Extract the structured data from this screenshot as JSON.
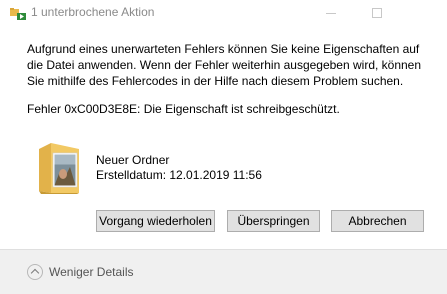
{
  "window": {
    "title": "1 unterbrochene Aktion",
    "title_icon": "folder-move-icon"
  },
  "dialog": {
    "message": "Aufgrund eines unerwarteten Fehlers können Sie keine Eigenschaften auf die Datei anwenden. Wenn der Fehler weiterhin ausgegeben wird, können Sie mithilfe des Fehlercodes in der Hilfe nach diesem Problem suchen.",
    "error": "Fehler 0xC00D3E8E: Die Eigenschaft ist schreibgeschützt.",
    "item": {
      "name": "Neuer Ordner",
      "created": "Erstelldatum: 12.01.2019 11:56",
      "icon": "folder-icon"
    },
    "buttons": {
      "retry": "Vorgang wiederholen",
      "skip": "Überspringen",
      "cancel": "Abbrechen"
    }
  },
  "footer": {
    "details_label": "Weniger Details",
    "details_icon": "chevron-up-icon"
  },
  "colors": {
    "footer_bg": "#f0f0f0",
    "button_bg": "#e1e1e1",
    "button_border": "#adadad",
    "title_text": "#8a8a8a"
  }
}
